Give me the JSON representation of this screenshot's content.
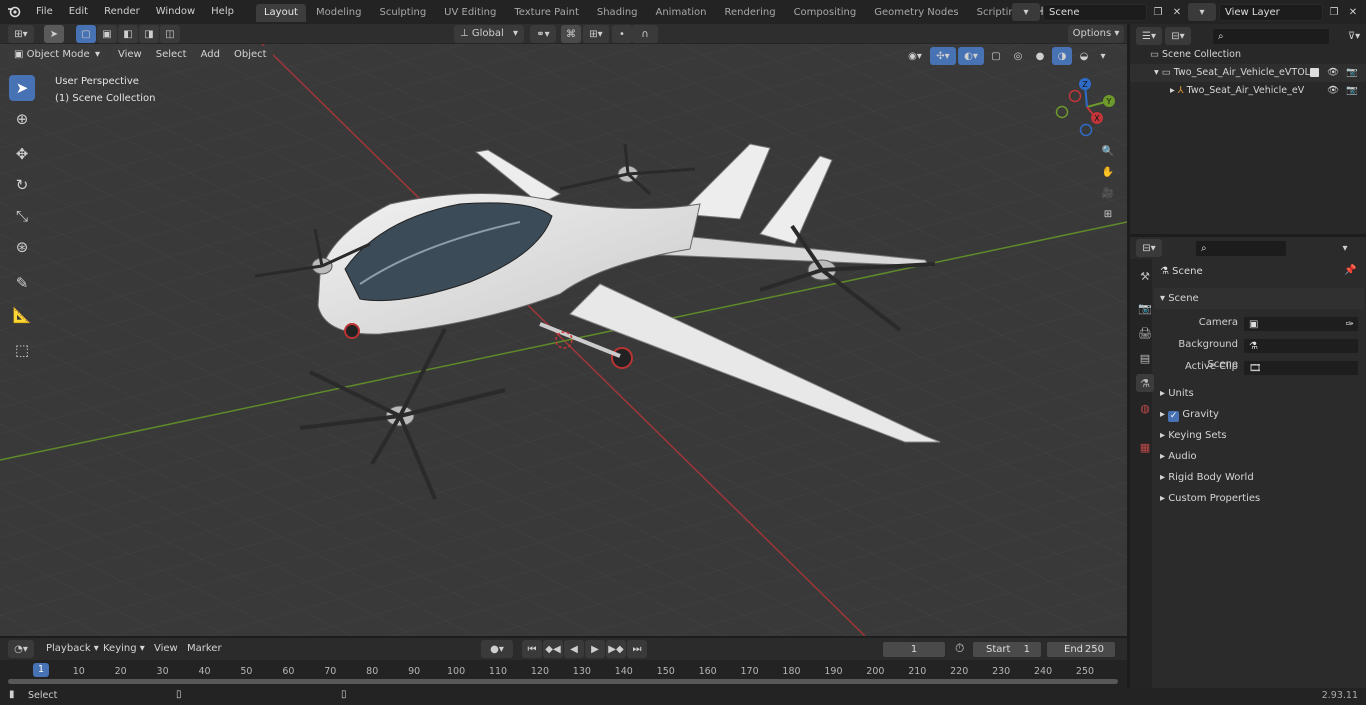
{
  "top_menu": [
    "File",
    "Edit",
    "Render",
    "Window",
    "Help"
  ],
  "workspaces": [
    {
      "label": "Layout",
      "active": true
    },
    {
      "label": "Modeling"
    },
    {
      "label": "Sculpting"
    },
    {
      "label": "UV Editing"
    },
    {
      "label": "Texture Paint"
    },
    {
      "label": "Shading"
    },
    {
      "label": "Animation"
    },
    {
      "label": "Rendering"
    },
    {
      "label": "Compositing"
    },
    {
      "label": "Geometry Nodes"
    },
    {
      "label": "Scripting"
    }
  ],
  "scene_name": "Scene",
  "view_layer": "View Layer",
  "viewport_header": {
    "mode": "Object Mode",
    "menus": [
      "View",
      "Select",
      "Add",
      "Object"
    ],
    "transform_orientation": "Global",
    "options_label": "Options"
  },
  "viewport_overlay": {
    "perspective": "User Perspective",
    "collection": "(1) Scene Collection"
  },
  "gizmo": {
    "x": "X",
    "y": "Y",
    "z": "Z"
  },
  "outliner": {
    "root": "Scene Collection",
    "items": [
      {
        "label": "Two_Seat_Air_Vehicle_eVTOL",
        "depth": 1
      },
      {
        "label": "Two_Seat_Air_Vehicle_eV",
        "depth": 2
      }
    ]
  },
  "properties": {
    "context": "Scene",
    "panel": "Scene",
    "fields": [
      {
        "label": "Camera",
        "value": ""
      },
      {
        "label": "Background Scene",
        "value": ""
      },
      {
        "label": "Active Clip",
        "value": ""
      }
    ],
    "subpanels": [
      {
        "label": "Units"
      },
      {
        "label": "Gravity",
        "checkbox": true
      },
      {
        "label": "Keying Sets"
      },
      {
        "label": "Audio"
      },
      {
        "label": "Rigid Body World"
      },
      {
        "label": "Custom Properties"
      }
    ]
  },
  "timeline": {
    "menus": [
      "Playback",
      "Keying",
      "View",
      "Marker"
    ],
    "current_frame": "1",
    "start_label": "Start",
    "start_value": "1",
    "end_label": "End",
    "end_value": "250",
    "ticks": [
      "1",
      "10",
      "20",
      "30",
      "40",
      "50",
      "60",
      "70",
      "80",
      "90",
      "100",
      "110",
      "120",
      "130",
      "140",
      "150",
      "160",
      "170",
      "180",
      "190",
      "200",
      "210",
      "220",
      "230",
      "240",
      "250"
    ]
  },
  "status": {
    "left": "Select",
    "version": "2.93.11"
  },
  "colors": {
    "accent": "#4772b3",
    "x_axis": "#c2363b",
    "y_axis": "#6d9a2a",
    "z_axis": "#2f6cc9"
  }
}
